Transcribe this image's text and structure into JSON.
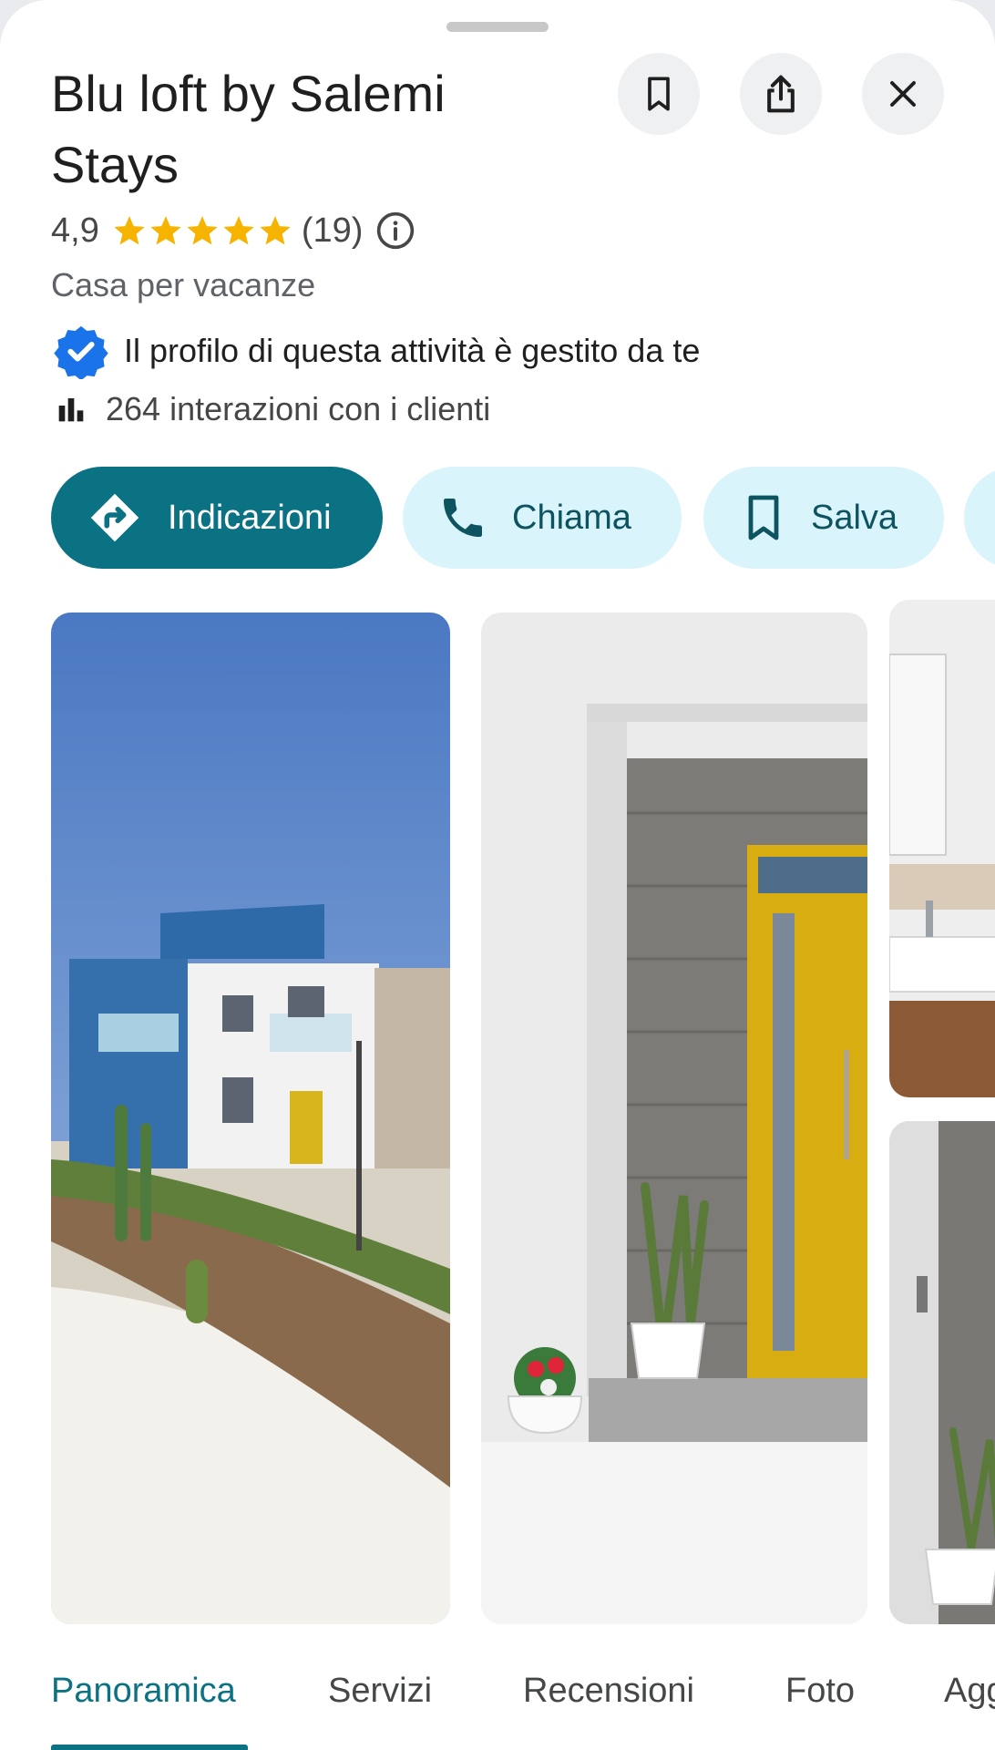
{
  "place": {
    "title": "Blu loft by Salemi Stays",
    "rating": "4,9",
    "stars": 5,
    "review_count": "(19)",
    "category": "Casa per vacanze",
    "managed_text": "Il profilo di questa attività è gestito da te",
    "interactions_text": "264 interazioni con i clienti"
  },
  "header_buttons": {
    "bookmark_icon": "bookmark-icon",
    "share_icon": "share-icon",
    "close_icon": "close-icon"
  },
  "actions": {
    "directions": "Indicazioni",
    "call": "Chiama",
    "save": "Salva"
  },
  "tabs": [
    {
      "label": "Panoramica",
      "active": true
    },
    {
      "label": "Servizi",
      "active": false
    },
    {
      "label": "Recensioni",
      "active": false
    },
    {
      "label": "Foto",
      "active": false
    },
    {
      "label": "Agg",
      "active": false
    }
  ],
  "colors": {
    "accent": "#0b7284",
    "chip_secondary": "#d9f4fb",
    "star": "#f6b400",
    "verified": "#1a73e8"
  }
}
